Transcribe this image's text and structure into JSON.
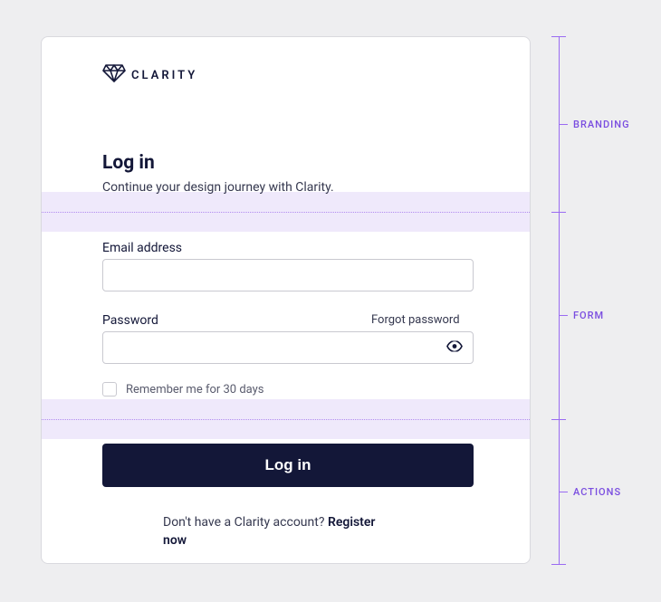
{
  "brand": {
    "name": "CLARITY"
  },
  "header": {
    "title": "Log in",
    "subtitle": "Continue your design journey with Clarity."
  },
  "form": {
    "email_label": "Email address",
    "email_value": "",
    "password_label": "Password",
    "password_value": "",
    "forgot_label": "Forgot password",
    "remember_label": "Remember me for 30 days"
  },
  "actions": {
    "login_label": "Log in",
    "register_prompt": "Don't have a Clarity account? ",
    "register_link": "Register now"
  },
  "annotations": {
    "branding": "BRANDING",
    "form": "FORM",
    "actions": "ACTIONS"
  },
  "colors": {
    "accent_purple": "#9a6bf2",
    "band": "#efe9fb",
    "ink": "#131738"
  }
}
